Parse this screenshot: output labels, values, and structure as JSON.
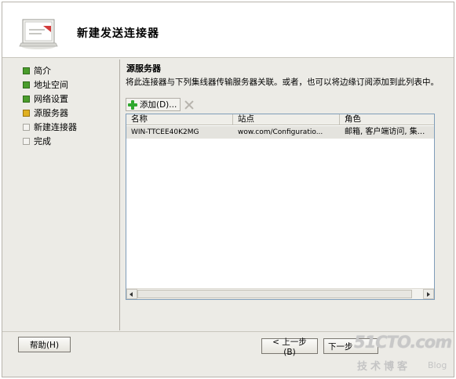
{
  "wizard": {
    "title": "新建发送连接器"
  },
  "steps": [
    {
      "label": "简介",
      "state": "done"
    },
    {
      "label": "地址空间",
      "state": "done"
    },
    {
      "label": "网络设置",
      "state": "done"
    },
    {
      "label": "源服务器",
      "state": "current"
    },
    {
      "label": "新建连接器",
      "state": "pending"
    },
    {
      "label": "完成",
      "state": "pending"
    }
  ],
  "content": {
    "title": "源服务器",
    "description": "将此连接器与下列集线器传输服务器关联。或者，也可以将边缘订阅添加到此列表中。",
    "add_button": "添加(D)..."
  },
  "table": {
    "columns": [
      "名称",
      "站点",
      "角色"
    ],
    "rows": [
      {
        "name": "WIN-TTCEE40K2MG",
        "site": "wow.com/Configuratio...",
        "role": "邮箱, 客户端访问, 集..."
      }
    ]
  },
  "buttons": {
    "help": "帮助(H)",
    "back": "< 上一步(B)",
    "next": "下一步"
  },
  "watermark": {
    "logo": "51CTO.com",
    "sub": "技术博客",
    "blog": "Blog"
  },
  "colors": {
    "step_done": "#4a9d2c",
    "step_current": "#e0b020",
    "step_pending": "#f4f3f0",
    "selected_row": "#e4e3de",
    "add_icon": "#2fa82f"
  }
}
